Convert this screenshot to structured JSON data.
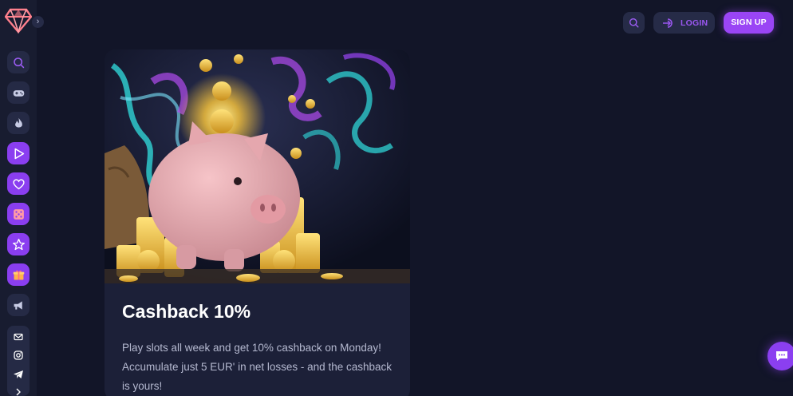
{
  "header": {
    "login_label": "LOGIN",
    "signup_label": "SIGN UP"
  },
  "sidebar": {
    "items": [
      {
        "icon": "search-icon",
        "style": "dark"
      },
      {
        "icon": "gamepad-icon",
        "style": "dark"
      },
      {
        "icon": "flame-icon",
        "style": "dark"
      },
      {
        "icon": "play-icon",
        "style": "purple"
      },
      {
        "icon": "heart-icon",
        "style": "purple"
      },
      {
        "icon": "dice-icon",
        "style": "purple"
      },
      {
        "icon": "star-icon",
        "style": "purple"
      },
      {
        "icon": "gift-icon",
        "style": "purple"
      },
      {
        "icon": "megaphone-icon",
        "style": "dark"
      }
    ],
    "social": [
      "mail-icon",
      "instagram-icon",
      "telegram-icon",
      "chevron-icon"
    ]
  },
  "promo": {
    "title": "Cashback 10%",
    "description": "Play slots all week and get 10% cashback on Monday! Accumulate just 5 EUR' in net losses - and the cashback is yours!"
  },
  "colors": {
    "background": "#121528",
    "sidebar": "#181c30",
    "accent": "#9a45f5",
    "card": "#1c2038"
  }
}
